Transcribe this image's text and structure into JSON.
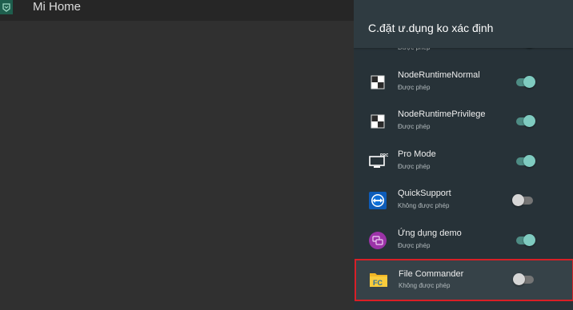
{
  "app_bar": {
    "title": "Mi Home",
    "icon": "mi-home-icon"
  },
  "panel": {
    "title": "C.đặt ư.dụng ko xác định",
    "apps": [
      {
        "name": "",
        "status": "Được phép",
        "enabled": true,
        "icon": "partial-app-icon"
      },
      {
        "name": "NodeRuntimeNormal",
        "status": "Được phép",
        "enabled": true,
        "icon": "grid-squares-icon"
      },
      {
        "name": "NodeRuntimePrivilege",
        "status": "Được phép",
        "enabled": true,
        "icon": "grid-squares-icon"
      },
      {
        "name": "Pro Mode",
        "status": "Được phép",
        "enabled": true,
        "icon": "pro-monitor-icon"
      },
      {
        "name": "QuickSupport",
        "status": "Không được phép",
        "enabled": false,
        "icon": "teamviewer-icon"
      },
      {
        "name": "Ứng dụng demo",
        "status": "Được phép",
        "enabled": true,
        "icon": "demo-app-icon"
      },
      {
        "name": "File Commander",
        "status": "Không được phép",
        "enabled": false,
        "icon": "file-commander-icon",
        "selected": true
      }
    ]
  },
  "colors": {
    "panel_bg": "#273238",
    "toggle_on": "#7fcbc0",
    "toggle_off": "#d6d6d6",
    "selection_border": "#d81f26"
  }
}
